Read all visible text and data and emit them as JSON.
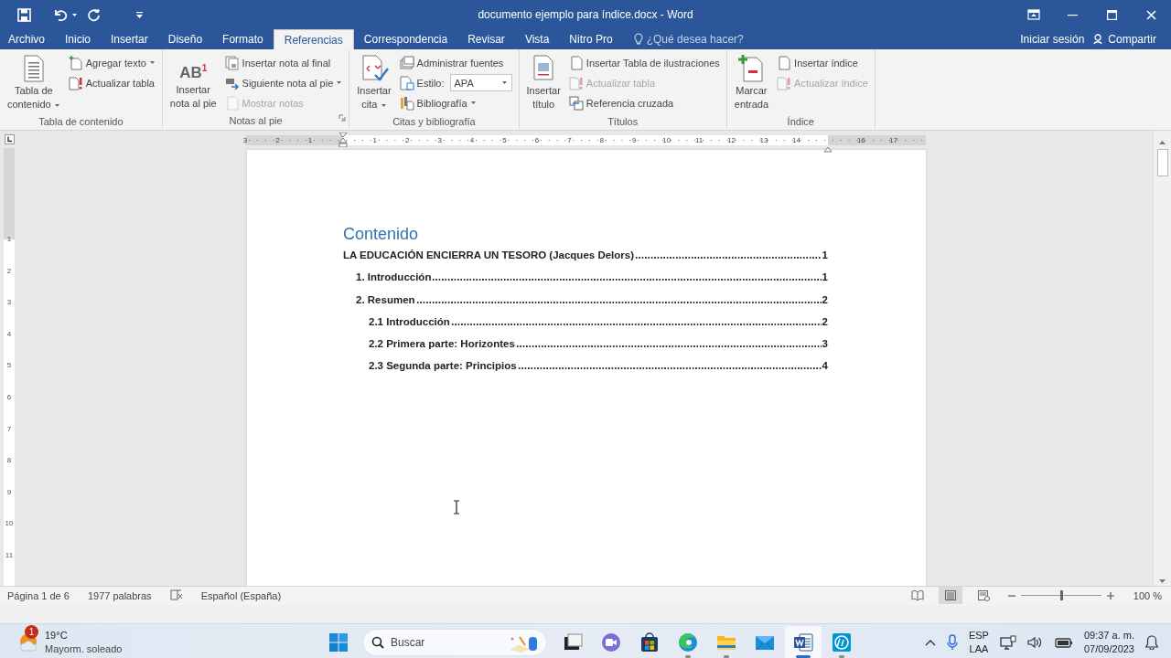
{
  "window": {
    "title": "documento ejemplo para índice.docx - Word"
  },
  "tabs": [
    {
      "label": "Archivo",
      "selected": false
    },
    {
      "label": "Inicio",
      "selected": false
    },
    {
      "label": "Insertar",
      "selected": false
    },
    {
      "label": "Diseño",
      "selected": false
    },
    {
      "label": "Formato",
      "selected": false
    },
    {
      "label": "Referencias",
      "selected": true
    },
    {
      "label": "Correspondencia",
      "selected": false
    },
    {
      "label": "Revisar",
      "selected": false
    },
    {
      "label": "Vista",
      "selected": false
    },
    {
      "label": "Nitro Pro",
      "selected": false
    }
  ],
  "tell_me": {
    "placeholder": "¿Qué desea hacer?"
  },
  "account": {
    "sign_in": "Iniciar sesión",
    "share": "Compartir"
  },
  "ribbon": {
    "groups": [
      {
        "label": "Tabla de contenido",
        "launcher": false,
        "items": [
          {
            "kind": "large",
            "label": "Tabla de\ncontenido",
            "dropdown": true,
            "disabled": false
          },
          {
            "kind": "stack",
            "items": [
              {
                "kind": "small",
                "label": "Agregar texto",
                "dropdown": true,
                "disabled": false
              },
              {
                "kind": "small",
                "label": "Actualizar tabla",
                "dropdown": false,
                "disabled": false
              }
            ]
          }
        ]
      },
      {
        "label": "Notas al pie",
        "launcher": true,
        "items": [
          {
            "kind": "large",
            "label": "Insertar\nnota al pie",
            "icon_text": "AB$^{1}$",
            "dropdown": false,
            "disabled": false
          },
          {
            "kind": "stack",
            "items": [
              {
                "kind": "small",
                "label": "Insertar nota al final",
                "dropdown": false,
                "disabled": false
              },
              {
                "kind": "small",
                "label": "Siguiente nota al pie",
                "dropdown": true,
                "disabled": false
              },
              {
                "kind": "small",
                "label": "Mostrar notas",
                "dropdown": false,
                "disabled": true
              }
            ]
          }
        ]
      },
      {
        "label": "Citas y bibliografía",
        "launcher": false,
        "items": [
          {
            "kind": "large",
            "label": "Insertar\ncita",
            "dropdown": true,
            "disabled": false
          },
          {
            "kind": "stack",
            "items": [
              {
                "kind": "small",
                "label": "Administrar fuentes",
                "dropdown": false,
                "disabled": false
              },
              {
                "kind": "combo",
                "label": "Estilo:",
                "value": "APA",
                "disabled": false
              },
              {
                "kind": "small",
                "label": "Bibliografía",
                "dropdown": true,
                "disabled": false
              }
            ]
          }
        ]
      },
      {
        "label": "Títulos",
        "launcher": false,
        "items": [
          {
            "kind": "large",
            "label": "Insertar\ntítulo",
            "dropdown": false,
            "disabled": false
          },
          {
            "kind": "stack",
            "items": [
              {
                "kind": "small",
                "label": "Insertar Tabla de ilustraciones",
                "dropdown": false,
                "disabled": false
              },
              {
                "kind": "small",
                "label": "Actualizar tabla",
                "dropdown": false,
                "disabled": true
              },
              {
                "kind": "small",
                "label": "Referencia cruzada",
                "dropdown": false,
                "disabled": false
              }
            ]
          }
        ]
      },
      {
        "label": "Índice",
        "launcher": false,
        "items": [
          {
            "kind": "large",
            "label": "Marcar\nentrada",
            "dropdown": false,
            "disabled": false
          },
          {
            "kind": "stack",
            "items": [
              {
                "kind": "small",
                "label": "Insertar índice",
                "dropdown": false,
                "disabled": false
              },
              {
                "kind": "small",
                "label": "Actualizar índice",
                "dropdown": false,
                "disabled": true
              }
            ]
          }
        ]
      }
    ]
  },
  "ruler": {
    "left_margin_labels": [
      "3",
      "2",
      "1"
    ],
    "body_labels": [
      "1",
      "2",
      "3",
      "4",
      "5",
      "6",
      "7",
      "8",
      "9",
      "10",
      "11",
      "12",
      "13",
      "14"
    ],
    "right_margin_labels": [
      "16",
      "17"
    ]
  },
  "vertical_ruler": {
    "labels": [
      "1",
      "2",
      "3",
      "4",
      "5",
      "6",
      "7",
      "8",
      "9",
      "10",
      "11"
    ]
  },
  "document": {
    "heading": "Contenido",
    "toc": [
      {
        "text": "LA EDUCACIÓN ENCIERRA UN TESORO (Jacques Delors)",
        "page": "1",
        "children": [
          {
            "text": "1. Introducción",
            "page": "1"
          },
          {
            "text": "2. Resumen",
            "page": "2",
            "children": [
              {
                "text": "2.1 Introducción",
                "page": "2"
              },
              {
                "text": "2.2 Primera parte: Horizontes",
                "page": "3"
              },
              {
                "text": "2.3 Segunda parte: Principios",
                "page": "4"
              }
            ]
          }
        ]
      }
    ]
  },
  "status_bar": {
    "page": "Página 1 de 6",
    "words": "1977 palabras",
    "language": "Español (España)",
    "views": [
      {
        "kind": "read",
        "selected": false
      },
      {
        "kind": "print",
        "selected": true
      },
      {
        "kind": "web",
        "selected": false
      }
    ],
    "zoom": {
      "level": 0.5,
      "reading": "100 %"
    }
  },
  "taskbar": {
    "weather": {
      "badge": "1",
      "temperature": "19°C",
      "condition": "Mayorm. soleado"
    },
    "search": {
      "placeholder": "Buscar"
    },
    "apps": [
      {
        "kind": "taskview",
        "running": false,
        "selected": false
      },
      {
        "kind": "chat",
        "running": false,
        "selected": false
      },
      {
        "kind": "store",
        "running": false,
        "selected": false
      },
      {
        "kind": "edge",
        "running": true,
        "selected": false
      },
      {
        "kind": "explorer",
        "running": true,
        "selected": false
      },
      {
        "kind": "mail",
        "running": false,
        "selected": false
      },
      {
        "kind": "word",
        "running": true,
        "selected": true
      },
      {
        "kind": "hp",
        "running": true,
        "selected": false
      }
    ],
    "tray": {
      "input_language": "ESP",
      "keyboard": "LAA",
      "time": "09:37 a. m.",
      "date": "07/09/2023"
    }
  }
}
